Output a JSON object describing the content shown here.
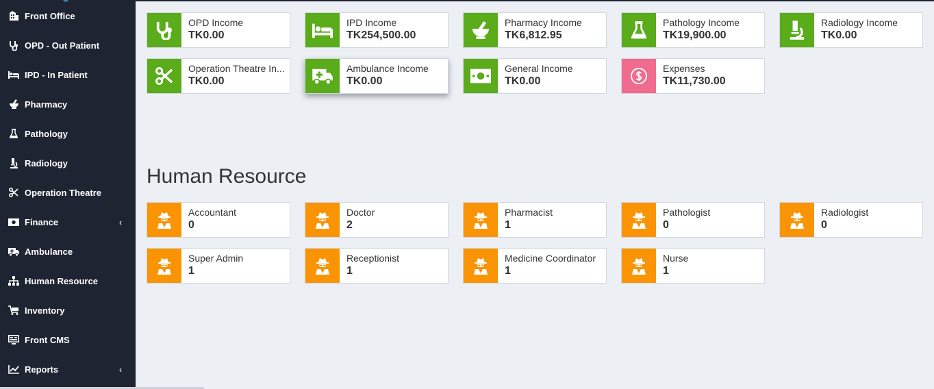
{
  "sidebar": {
    "items": [
      {
        "label": "Front Office",
        "icon": "building-icon"
      },
      {
        "label": "OPD - Out Patient",
        "icon": "stethoscope-icon"
      },
      {
        "label": "IPD - In Patient",
        "icon": "bed-icon"
      },
      {
        "label": "Pharmacy",
        "icon": "mortar-pestle-icon"
      },
      {
        "label": "Pathology",
        "icon": "flask-icon"
      },
      {
        "label": "Radiology",
        "icon": "microscope-icon"
      },
      {
        "label": "Operation Theatre",
        "icon": "scissors-icon"
      },
      {
        "label": "Finance",
        "icon": "money-icon",
        "chevron": "‹"
      },
      {
        "label": "Ambulance",
        "icon": "ambulance-icon"
      },
      {
        "label": "Human Resource",
        "icon": "sitemap-icon"
      },
      {
        "label": "Inventory",
        "icon": "cart-icon"
      },
      {
        "label": "Front CMS",
        "icon": "tv-icon"
      },
      {
        "label": "Reports",
        "icon": "line-chart-icon",
        "chevron": "‹"
      }
    ]
  },
  "income_cards": [
    {
      "title": "OPD Income",
      "value": "TK0.00",
      "icon": "stethoscope-icon",
      "color": "#5aac1b"
    },
    {
      "title": "IPD Income",
      "value": "TK254,500.00",
      "icon": "bed-icon",
      "color": "#5aac1b"
    },
    {
      "title": "Pharmacy Income",
      "value": "TK6,812.95",
      "icon": "mortar-pestle-icon",
      "color": "#5aac1b"
    },
    {
      "title": "Pathology Income",
      "value": "TK19,900.00",
      "icon": "flask-icon",
      "color": "#5aac1b"
    },
    {
      "title": "Radiology Income",
      "value": "TK0.00",
      "icon": "microscope-icon",
      "color": "#5aac1b"
    },
    {
      "title": "Operation Theatre In...",
      "value": "TK0.00",
      "icon": "scissors-icon",
      "color": "#5aac1b"
    },
    {
      "title": "Ambulance Income",
      "value": "TK0.00",
      "icon": "ambulance-icon",
      "color": "#5aac1b"
    },
    {
      "title": "General Income",
      "value": "TK0.00",
      "icon": "money-icon",
      "color": "#5aac1b"
    },
    {
      "title": "Expenses",
      "value": "TK11,730.00",
      "icon": "dollar-circle-icon",
      "color": "#f06b8d"
    }
  ],
  "human_resource": {
    "title": "Human Resource",
    "cards": [
      {
        "title": "Accountant",
        "value": "0",
        "icon": "user-secret-icon"
      },
      {
        "title": "Doctor",
        "value": "2",
        "icon": "user-secret-icon"
      },
      {
        "title": "Pharmacist",
        "value": "1",
        "icon": "user-secret-icon"
      },
      {
        "title": "Pathologist",
        "value": "0",
        "icon": "user-secret-icon"
      },
      {
        "title": "Radiologist",
        "value": "0",
        "icon": "user-secret-icon"
      },
      {
        "title": "Super Admin",
        "value": "1",
        "icon": "user-secret-icon"
      },
      {
        "title": "Receptionist",
        "value": "1",
        "icon": "user-secret-icon"
      },
      {
        "title": "Medicine Coordinator",
        "value": "1",
        "icon": "user-secret-icon"
      },
      {
        "title": "Nurse",
        "value": "1",
        "icon": "user-secret-icon"
      }
    ],
    "color": "#fb9405"
  }
}
